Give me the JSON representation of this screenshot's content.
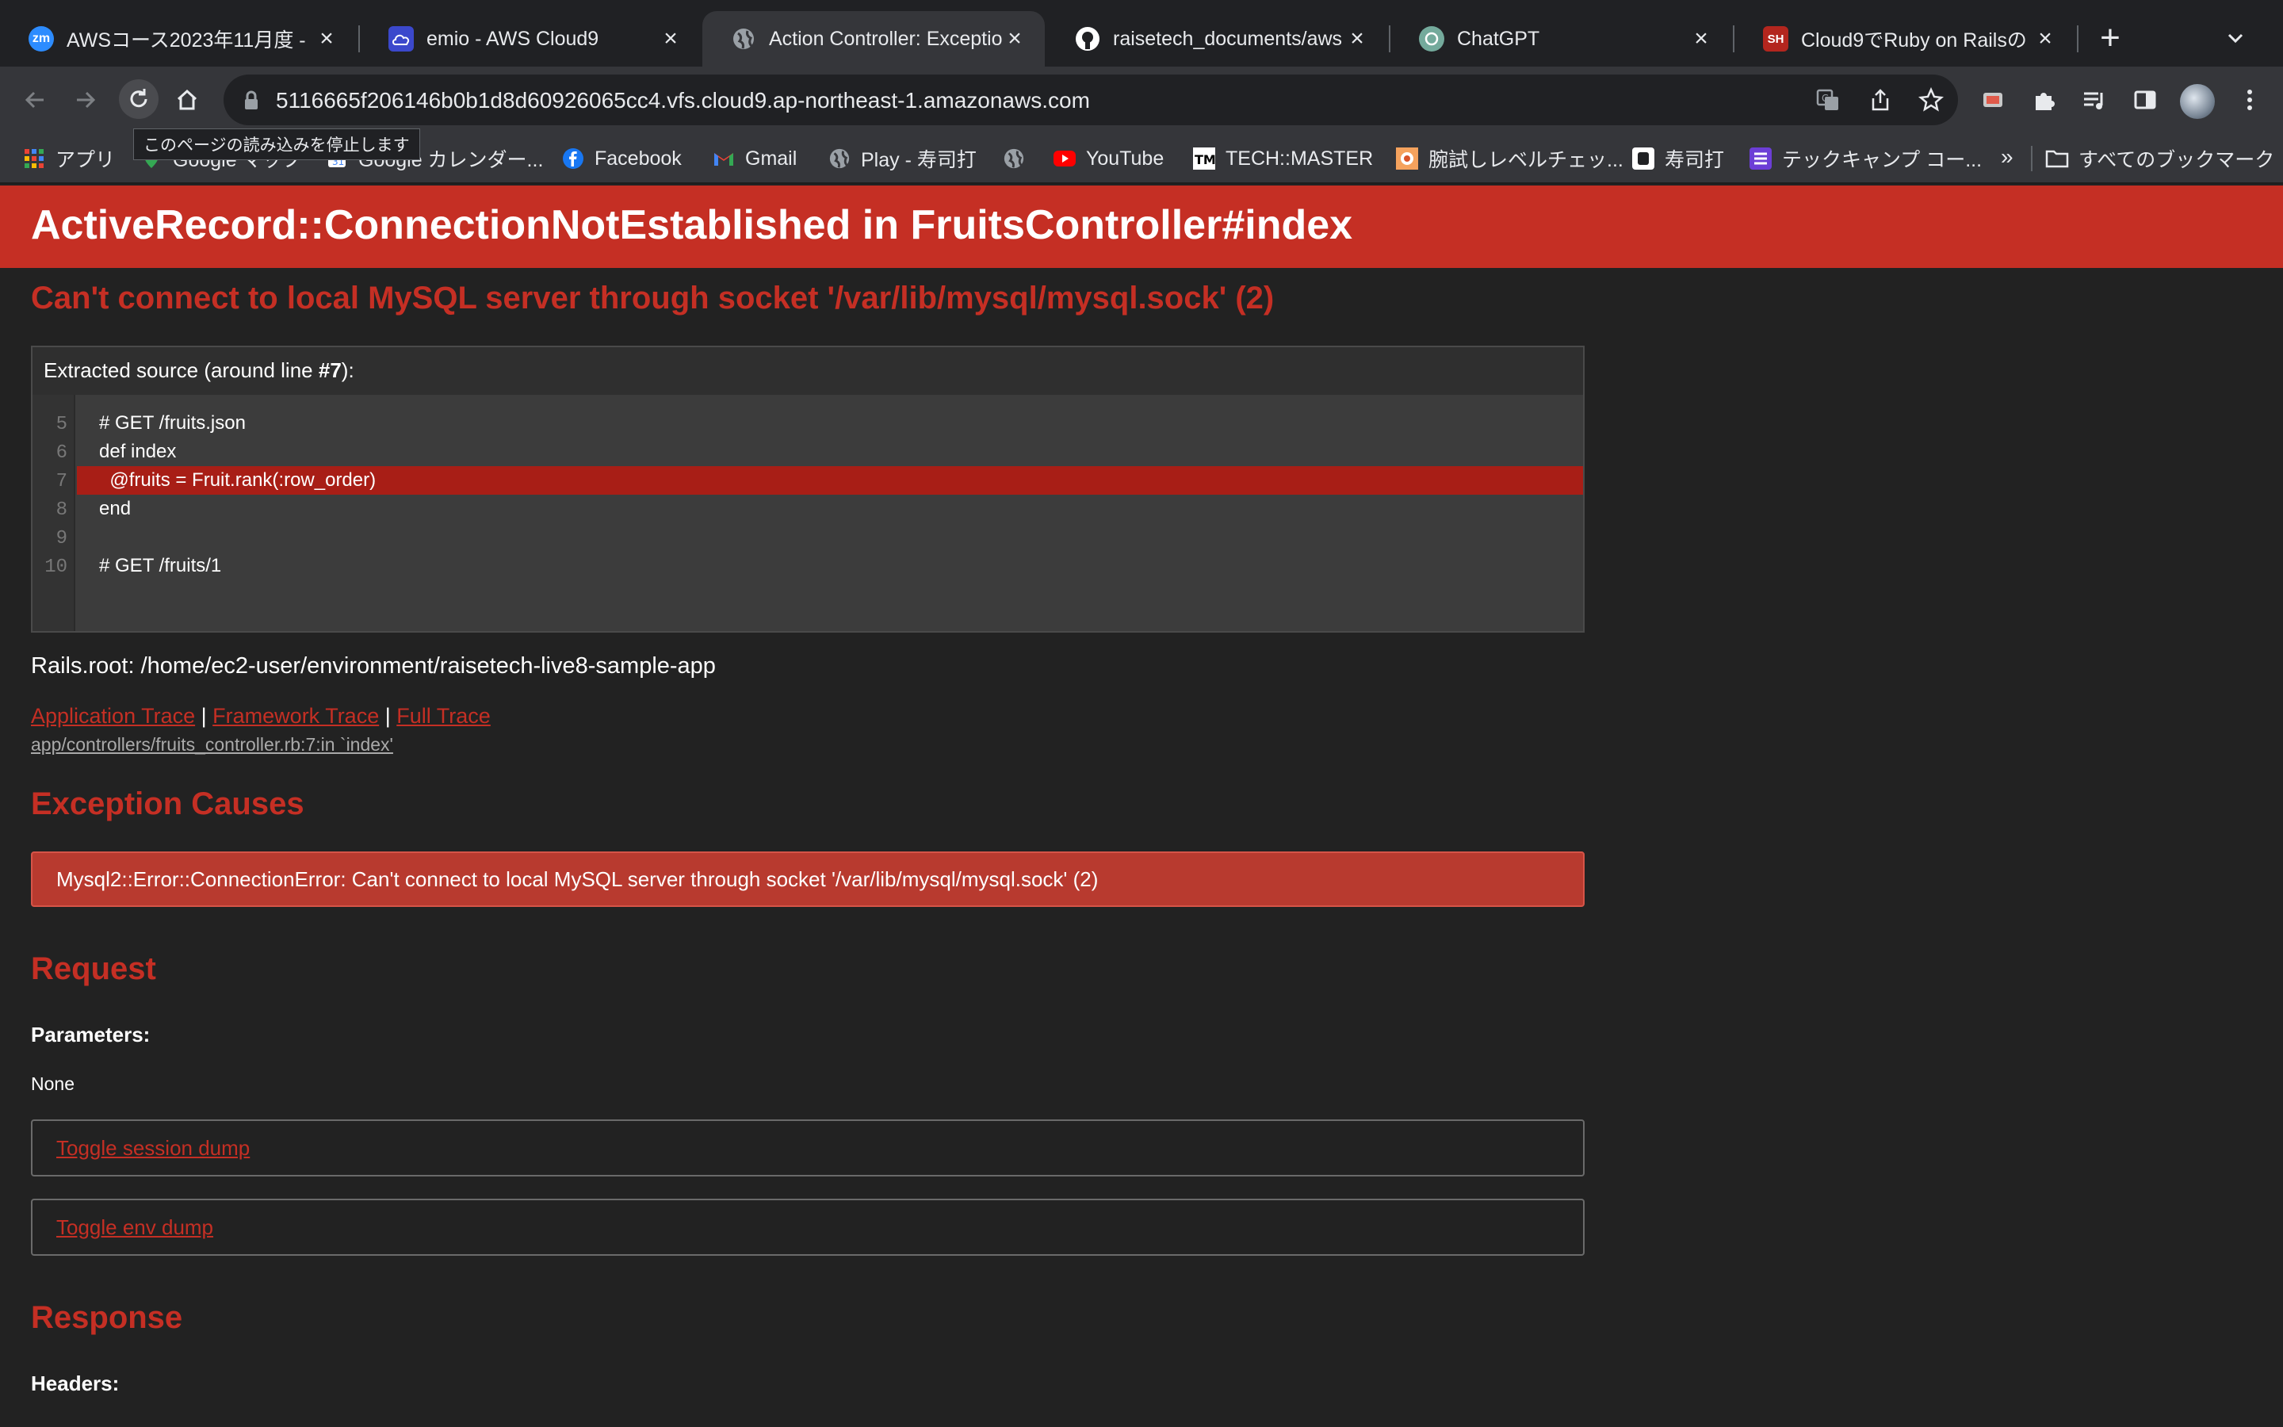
{
  "browser": {
    "tabs": [
      {
        "title": "AWSコース2023年11月度 - ",
        "favicon_text": "zm",
        "favicon_color": "#2d8cff"
      },
      {
        "title": "emio - AWS Cloud9",
        "favicon_text": "",
        "favicon_color": "#3b48cc"
      },
      {
        "title": "Action Controller: Exceptio",
        "favicon_text": "",
        "favicon_color": "#9aa0a6"
      },
      {
        "title": "raisetech_documents/aws",
        "favicon_text": "",
        "favicon_color": "#ffffff"
      },
      {
        "title": "ChatGPT",
        "favicon_text": "",
        "favicon_color": "#74aa9c"
      },
      {
        "title": "Cloud9でRuby on Railsの",
        "favicon_text": "SH",
        "favicon_color": "#b3261e"
      }
    ],
    "active_tab_index": 2,
    "new_tab_label": "+",
    "url": "5116665f206146b0b1d8d60926065cc4.vfs.cloud9.ap-northeast-1.amazonaws.com",
    "tooltip": "このページの読み込みを停止します",
    "bookmarks": [
      {
        "label": "アプリ",
        "icon": "apps-grid-icon"
      },
      {
        "label": "Google マップ",
        "icon": "google-maps-icon"
      },
      {
        "label": "Google カレンダー...",
        "icon": "google-calendar-icon"
      },
      {
        "label": "Facebook",
        "icon": "facebook-icon"
      },
      {
        "label": "Gmail",
        "icon": "gmail-icon"
      },
      {
        "label": "Play - 寿司打",
        "icon": "globe-icon"
      },
      {
        "label": "",
        "icon": "globe-icon"
      },
      {
        "label": "YouTube",
        "icon": "youtube-icon"
      },
      {
        "label": "TECH::MASTER",
        "icon": "techmaster-icon"
      },
      {
        "label": "腕試しレベルチェッ...",
        "icon": "level-check-icon"
      },
      {
        "label": "寿司打",
        "icon": "sushida-icon"
      },
      {
        "label": "テックキャンプ コー...",
        "icon": "techcamp-icon"
      }
    ],
    "bookmarks_more": "»",
    "all_bookmarks_label": "すべてのブックマーク"
  },
  "page": {
    "header_title": "ActiveRecord::ConnectionNotEstablished in FruitsController#index",
    "error_message": "Can't connect to local MySQL server through socket '/var/lib/mysql/mysql.sock' (2)",
    "source": {
      "title_prefix": "Extracted source (around line ",
      "title_line": "#7",
      "title_suffix": "):",
      "lines": [
        {
          "number": "5",
          "code": "# GET /fruits.json"
        },
        {
          "number": "6",
          "code": "def index"
        },
        {
          "number": "7",
          "code": "  @fruits = Fruit.rank(:row_order)"
        },
        {
          "number": "8",
          "code": "end"
        },
        {
          "number": "9",
          "code": ""
        },
        {
          "number": "10",
          "code": "# GET /fruits/1"
        }
      ],
      "highlighted_line": "7"
    },
    "rails_root": "Rails.root: /home/ec2-user/environment/raisetech-live8-sample-app",
    "trace_links": {
      "application": "Application Trace",
      "framework": "Framework Trace",
      "full": "Full Trace",
      "separator": "|"
    },
    "trace_line": "app/controllers/fruits_controller.rb:7:in `index'",
    "exception_causes_heading": "Exception Causes",
    "cause": "Mysql2::Error::ConnectionError: Can't connect to local MySQL server through socket '/var/lib/mysql/mysql.sock' (2)",
    "request_heading": "Request",
    "parameters_label": "Parameters",
    "parameters_value": "None",
    "toggle_session": "Toggle session dump",
    "toggle_env": "Toggle env dump",
    "response_heading": "Response",
    "headers_label": "Headers"
  },
  "colors": {
    "rails_red": "#c52f24",
    "page_bg": "#222222",
    "chrome_dark": "#202124",
    "chrome_toolbar": "#35363a"
  }
}
